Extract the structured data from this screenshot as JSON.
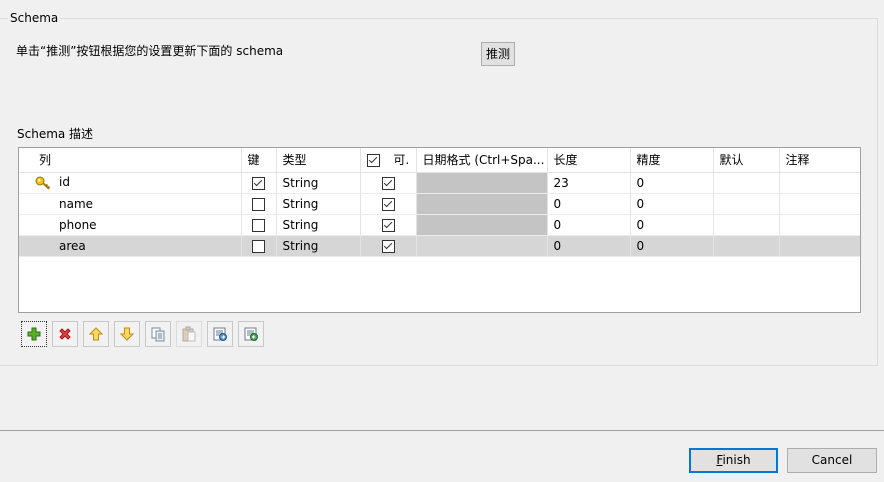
{
  "group_title": "Schema",
  "instruction": "单击“推测”按钮根据您的设置更新下面的 schema",
  "guess_button": "推测",
  "schema_label": "Schema 描述",
  "table": {
    "headers": {
      "column": "列",
      "key": "键",
      "type": "类型",
      "nullable": "可.",
      "date_format": "日期格式 (Ctrl+Spa...",
      "length": "长度",
      "precision": "精度",
      "default": "默认",
      "comment": "注释"
    },
    "nullable_header_checked": true,
    "rows": [
      {
        "name": "id",
        "key": true,
        "type": "String",
        "nullable": true,
        "length": "23",
        "precision": "0",
        "default": "",
        "comment": "",
        "selected": false
      },
      {
        "name": "name",
        "key": false,
        "type": "String",
        "nullable": true,
        "length": "0",
        "precision": "0",
        "default": "",
        "comment": "",
        "selected": false
      },
      {
        "name": "phone",
        "key": false,
        "type": "String",
        "nullable": true,
        "length": "0",
        "precision": "0",
        "default": "",
        "comment": "",
        "selected": false
      },
      {
        "name": "area",
        "key": false,
        "type": "String",
        "nullable": true,
        "length": "0",
        "precision": "0",
        "default": "",
        "comment": "",
        "selected": true
      }
    ]
  },
  "toolbar": [
    {
      "name": "add-row",
      "icon": "plus-icon",
      "enabled": true
    },
    {
      "name": "remove-row",
      "icon": "delete-icon",
      "enabled": true
    },
    {
      "name": "move-up",
      "icon": "arrow-up-icon",
      "enabled": true
    },
    {
      "name": "move-down",
      "icon": "arrow-down-icon",
      "enabled": true
    },
    {
      "name": "copy",
      "icon": "copy-icon",
      "enabled": true
    },
    {
      "name": "paste",
      "icon": "paste-icon",
      "enabled": false
    },
    {
      "name": "import-schema",
      "icon": "import-icon",
      "enabled": true
    },
    {
      "name": "export-schema",
      "icon": "export-icon",
      "enabled": true
    }
  ],
  "buttons": {
    "finish": "Finish",
    "finish_mnemonic": "F",
    "finish_rest": "inish",
    "cancel": "Cancel"
  }
}
